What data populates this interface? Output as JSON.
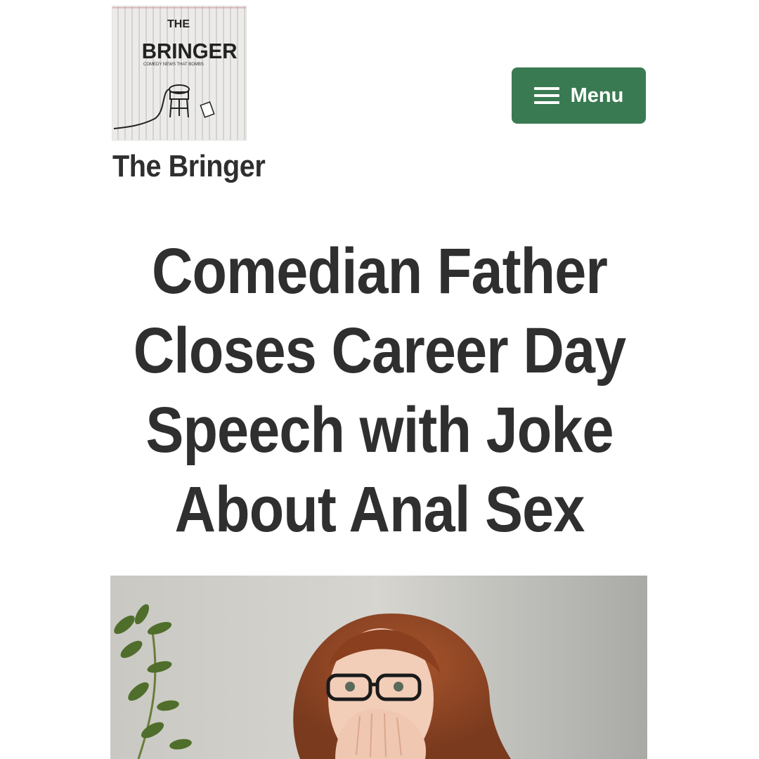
{
  "header": {
    "logo": {
      "title_small": "THE",
      "title_big": "BRINGER",
      "tagline": "COMEDY NEWS THAT BOMBS"
    },
    "site_title": "The Bringer",
    "menu_button": {
      "label": "Menu",
      "icon": "hamburger-icon",
      "color": "#3a7a52"
    }
  },
  "article": {
    "headline": "Comedian Father Closes Career Day Speech with Joke About Anal Sex",
    "featured_image": {
      "subject": "shocked woman with glasses covering mouth"
    }
  }
}
